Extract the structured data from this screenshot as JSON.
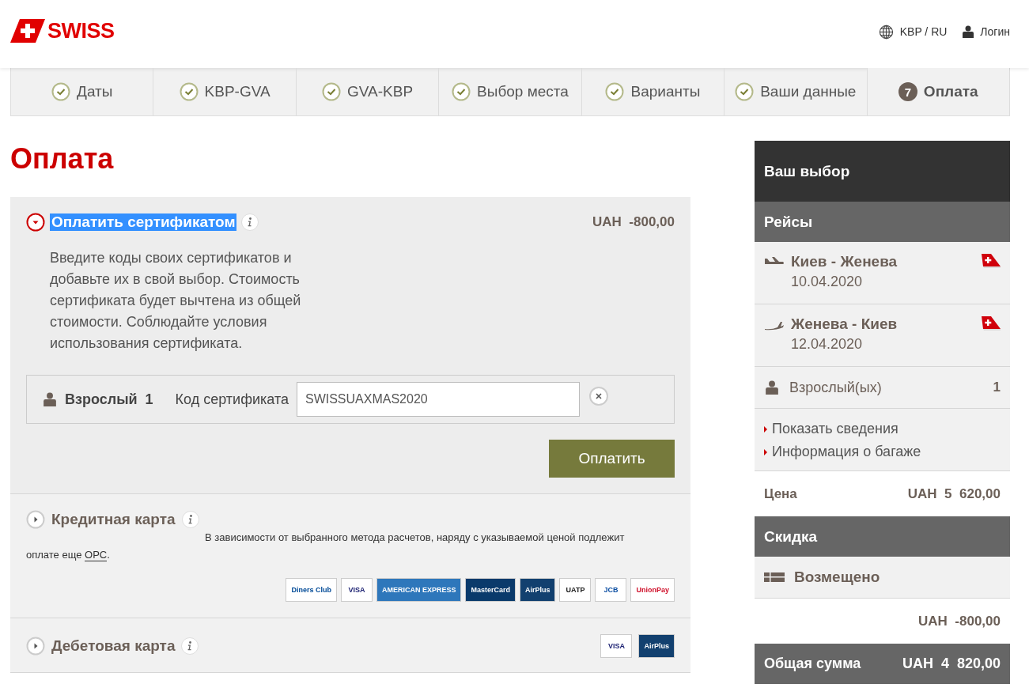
{
  "header": {
    "logo": "SWISS",
    "locale": "KBP / RU",
    "login": "Логин"
  },
  "steps": [
    {
      "label": "Даты",
      "done": true,
      "selected": false
    },
    {
      "label": "KBP-GVA",
      "done": true,
      "selected": false
    },
    {
      "label": "GVA-KBP",
      "done": true,
      "selected": false
    },
    {
      "label": "Выбор места",
      "done": true,
      "selected": false
    },
    {
      "label": "Варианты",
      "done": true,
      "selected": false
    },
    {
      "label": "Ваши данные",
      "done": true,
      "selected": false
    },
    {
      "label": "Оплата",
      "done": false,
      "number": "7",
      "selected": true
    }
  ],
  "page_title": "Оплата",
  "certificate": {
    "title": "Оплатить сертификатом",
    "highlighted": true,
    "expanded": true,
    "amount": "UAH  -800,00",
    "description": "Введите коды своих сертификатов и добавьте их в свой выбор. Стоимость сертификата будет вычтена из общей стоимости. Соблюдайте условия использования сертификата.",
    "passenger": "Взрослый",
    "passenger_count": "1",
    "code_label": "Код сертификата",
    "code_value": "SWISSUAXMAS2020",
    "pay_button": "Оплатить"
  },
  "credit_card": {
    "title": "Кредитная карта",
    "expanded": false,
    "note": "В зависимости от выбранного метода расчетов, наряду с указываемой ценой подлежит оплате еще ",
    "note_link": "OPC",
    "note_end": ".",
    "cards": [
      {
        "label": "Diners Club",
        "kind": "diners"
      },
      {
        "label": "VISA",
        "kind": "visa"
      },
      {
        "label": "AMERICAN EXPRESS",
        "kind": "amex"
      },
      {
        "label": "MasterCard",
        "kind": "mastercard"
      },
      {
        "label": "AirPlus",
        "kind": "airplus"
      },
      {
        "label": "UATP",
        "kind": "uatp"
      },
      {
        "label": "JCB",
        "kind": "jcb"
      },
      {
        "label": "UnionPay",
        "kind": "unionpay"
      }
    ]
  },
  "debit_card": {
    "title": "Дебетовая карта",
    "expanded": false,
    "cards": [
      {
        "label": "VISA",
        "kind": "visa"
      },
      {
        "label": "AirPlus",
        "kind": "airplus"
      }
    ]
  },
  "summary": {
    "title": "Ваш выбор",
    "flights_heading": "Рейсы",
    "flights": [
      {
        "route": "Киев - Женева",
        "date": "10.04.2020",
        "kind": "departure"
      },
      {
        "route": "Женева - Киев",
        "date": "12.04.2020",
        "kind": "arrival"
      }
    ],
    "passengers_label": "Взрослый(ых)",
    "passengers_count": "1",
    "links": [
      "Показать сведения",
      "Информация о багаже"
    ],
    "price_label": "Цена",
    "price": "UAH  5  620,00",
    "discount_heading": "Скидка",
    "discount_label": "Возмещено",
    "discount_amount": "UAH  -800,00",
    "total_label": "Общая сумма",
    "total": "UAH  4  820,00"
  }
}
